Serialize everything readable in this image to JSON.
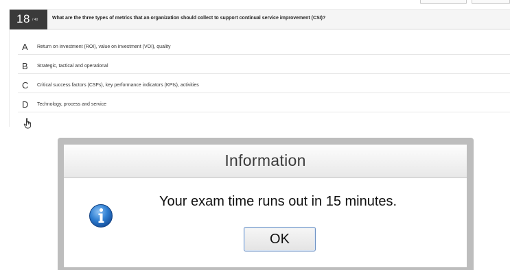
{
  "question": {
    "number": "18",
    "total": "/ 40",
    "text": "What are the three types of metrics that an organization should collect to support continual service improvement (CSI)?"
  },
  "answers": [
    {
      "letter": "A",
      "text": "Return on investment (ROI), value on investment (VOI), quality"
    },
    {
      "letter": "B",
      "text": "Strategic, tactical and operational"
    },
    {
      "letter": "C",
      "text": "Critical success factors (CSFs), key performance indicators (KPIs), activities"
    },
    {
      "letter": "D",
      "text": "Technology, process and service"
    }
  ],
  "dialog": {
    "title": "Information",
    "message": "Your exam time runs out in 15 minutes.",
    "ok_label": "OK"
  },
  "colors": {
    "question_badge_bg": "#3a3a3a",
    "info_icon_blue": "#1f5fae",
    "ok_border": "#6f93c4"
  },
  "icons": {
    "pointer": "hand-pointer-icon",
    "info": "info-icon"
  }
}
